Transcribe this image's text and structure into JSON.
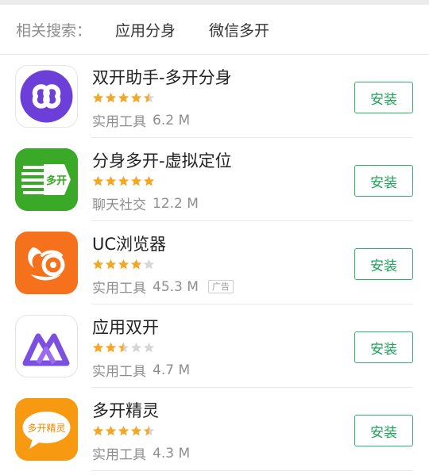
{
  "related": {
    "label": "相关搜索：",
    "links": [
      "应用分身",
      "微信多开"
    ]
  },
  "apps": [
    {
      "name": "双开助手-多开分身",
      "rating": 4.5,
      "category": "实用工具",
      "size": "6.2 M",
      "ad": "",
      "install": "安装",
      "icon": "infinity-icon",
      "icon_text": ""
    },
    {
      "name": "分身多开-虚拟定位",
      "rating": 5,
      "category": "聊天社交",
      "size": "12.2 M",
      "ad": "",
      "install": "安装",
      "icon": "multi-open-icon",
      "icon_text": "多开"
    },
    {
      "name": "UC浏览器",
      "rating": 4,
      "category": "实用工具",
      "size": "45.3 M",
      "ad": "广告",
      "install": "安装",
      "icon": "squirrel-icon",
      "icon_text": ""
    },
    {
      "name": "应用双开",
      "rating": 2.5,
      "category": "实用工具",
      "size": "4.7 M",
      "ad": "",
      "install": "安装",
      "icon": "mountain-icon",
      "icon_text": ""
    },
    {
      "name": "多开精灵",
      "rating": 4.5,
      "category": "实用工具",
      "size": "4.3 M",
      "ad": "",
      "install": "安装",
      "icon": "speech-bubble-icon",
      "icon_text": "多开精灵"
    }
  ],
  "colors": {
    "install_border": "#2db36a",
    "install_text": "#1ea35a",
    "star_on": "#f5a623",
    "star_off": "#d6d6d6"
  }
}
